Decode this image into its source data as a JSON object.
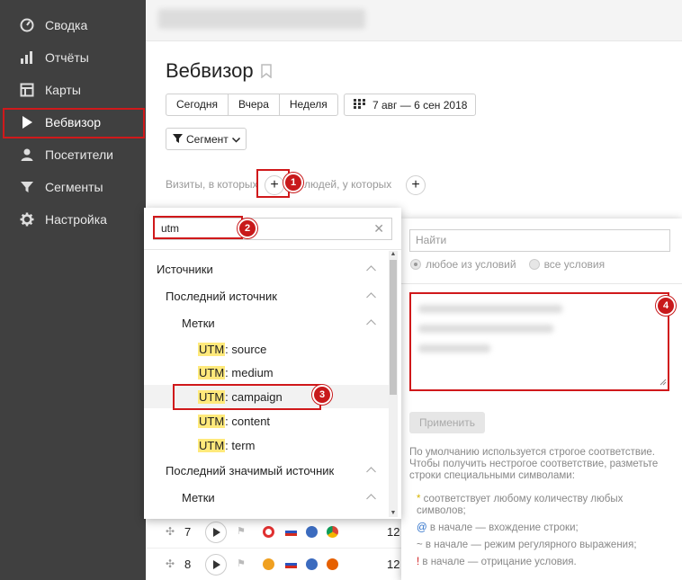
{
  "sidebar": {
    "items": [
      {
        "label": "Сводка",
        "icon": "gauge-icon"
      },
      {
        "label": "Отчёты",
        "icon": "bar-chart-icon"
      },
      {
        "label": "Карты",
        "icon": "map-layout-icon"
      },
      {
        "label": "Вебвизор",
        "icon": "play-icon",
        "active": true
      },
      {
        "label": "Посетители",
        "icon": "user-icon"
      },
      {
        "label": "Сегменты",
        "icon": "funnel-icon"
      },
      {
        "label": "Настройка",
        "icon": "gear-icon"
      }
    ]
  },
  "header": {
    "title": "Вебвизор",
    "period_buttons": [
      "Сегодня",
      "Вчера",
      "Неделя"
    ],
    "date_range": "7 авг — 6 сен 2018",
    "segment_button": "Сегмент"
  },
  "filter": {
    "visits_label": "Визиты, в которых",
    "people_label": "людей, у которых"
  },
  "badges": [
    "1",
    "2",
    "3",
    "4"
  ],
  "left_panel": {
    "search_value": "utm",
    "tree": [
      {
        "label": "Источники",
        "level": 0,
        "collapsible": true
      },
      {
        "label": "Последний источник",
        "level": 1,
        "collapsible": true
      },
      {
        "label": "Метки",
        "level": 2,
        "collapsible": true
      },
      {
        "prefix": "UTM",
        "suffix": ": source",
        "level": 3
      },
      {
        "prefix": "UTM",
        "suffix": ": medium",
        "level": 3
      },
      {
        "prefix": "UTM",
        "suffix": ": campaign",
        "level": 3,
        "selected": true
      },
      {
        "prefix": "UTM",
        "suffix": ": content",
        "level": 3
      },
      {
        "prefix": "UTM",
        "suffix": ": term",
        "level": 3
      },
      {
        "label": "Последний значимый источник",
        "level": 1,
        "collapsible": true
      },
      {
        "label": "Метки",
        "level": 2,
        "collapsible": true
      }
    ]
  },
  "right_panel": {
    "find_placeholder": "Найти",
    "radio_any": "любое из условий",
    "radio_all": "все условия",
    "apply_label": "Применить",
    "help_text": "По умолчанию используется строгое соответствие. Чтобы получить нестрогое соответствие, разметьте строки специальными символами:",
    "rules": [
      {
        "symbol": "*",
        "text": " соответствует любому количеству любых символов;"
      },
      {
        "symbol": "@",
        "text": " в начале — вхождение строки;"
      },
      {
        "symbol": "~",
        "text": " в начале — режим регулярного выражения;"
      },
      {
        "symbol": "!",
        "text": " в начале — отрицание условия."
      }
    ]
  },
  "rows": [
    {
      "num": "7",
      "tail": "12"
    },
    {
      "num": "8",
      "tail": "12"
    }
  ],
  "colors": {
    "sidebar": "#404040",
    "highlight_red": "#d0191b",
    "utm_highlight": "#ffe97b"
  }
}
